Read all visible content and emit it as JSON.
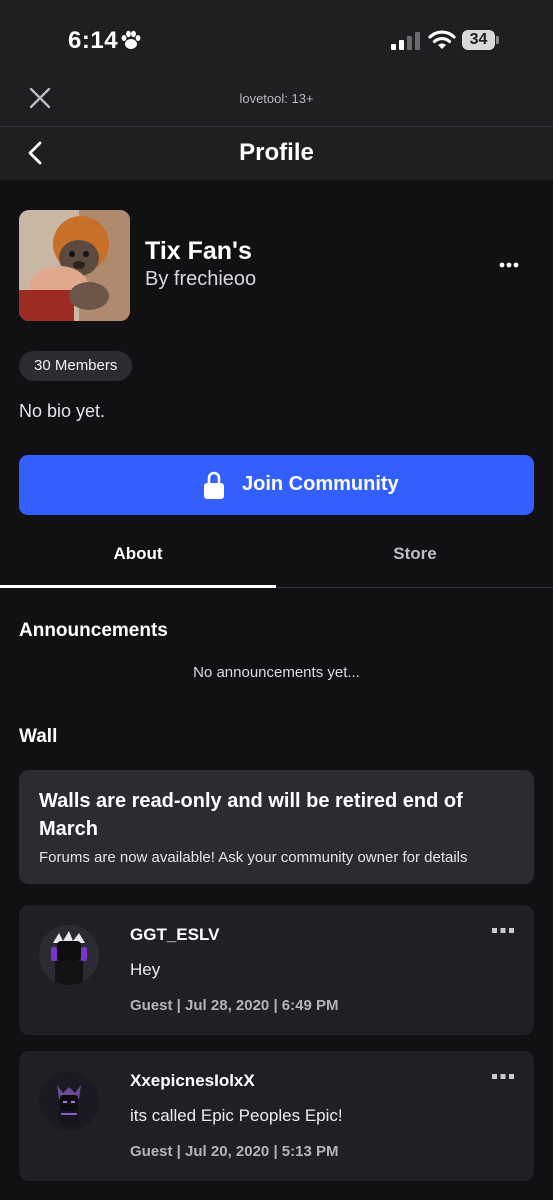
{
  "status": {
    "time": "6:14",
    "battery": "34"
  },
  "browser": {
    "title": "lovetool: 13+"
  },
  "nav": {
    "title": "Profile"
  },
  "group": {
    "name": "Tix Fan's",
    "owner": "By frechieoo",
    "members": "30 Members",
    "bio": "No bio yet.",
    "join_label": "Join Community"
  },
  "tabs": [
    "About",
    "Store"
  ],
  "announcements": {
    "heading": "Announcements",
    "empty": "No announcements yet..."
  },
  "wall": {
    "heading": "Wall",
    "notice_title": "Walls are read-only and will be retired end of March",
    "notice_body": "Forums are now available! Ask your community owner for details",
    "posts": [
      {
        "author": "GGT_ESLV",
        "text": "Hey",
        "meta": "Guest | Jul 28, 2020 | 6:49 PM"
      },
      {
        "author": "XxepicnesIolxX",
        "text": "its called Epic Peoples Epic!",
        "meta": "Guest | Jul 20, 2020 | 5:13 PM"
      }
    ]
  },
  "colors": {
    "accent": "#335fff",
    "background": "#111114",
    "card": "#1f2024"
  }
}
